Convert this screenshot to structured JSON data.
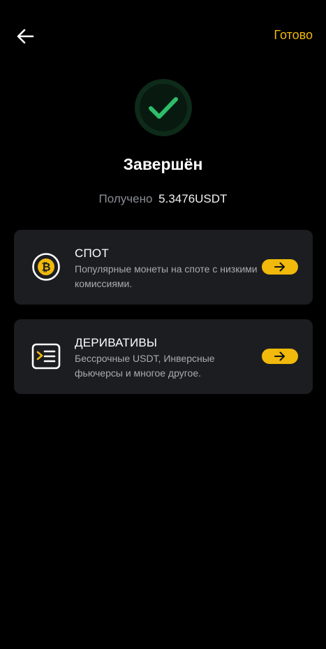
{
  "colors": {
    "accent": "#F0B90B",
    "success": "#2EBD6A",
    "card_bg": "#1c1d21",
    "background": "#000000"
  },
  "header": {
    "back_icon": "arrow-left-icon",
    "done_label": "Готово"
  },
  "status": {
    "icon": "check-circle-icon",
    "title": "Завершён",
    "received_label": "Получено",
    "received_value": "5.3476USDT"
  },
  "cards": [
    {
      "icon": "bitcoin-icon",
      "title": "СПОТ",
      "description": "Популярные монеты на споте с низкими комиссиями.",
      "action_icon": "arrow-right-icon"
    },
    {
      "icon": "terminal-icon",
      "title": "ДЕРИВАТИВЫ",
      "description": "Бессрочные USDT, Инверсные фьючерсы и многое другое.",
      "action_icon": "arrow-right-icon"
    }
  ]
}
